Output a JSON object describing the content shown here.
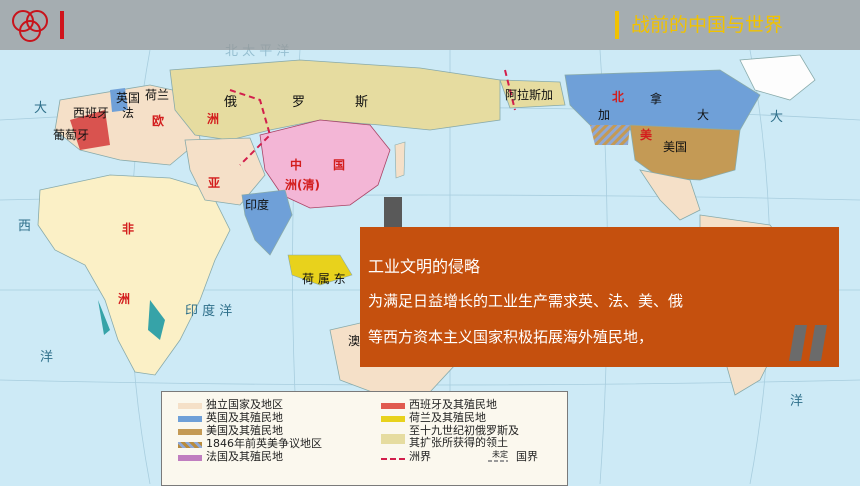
{
  "header": {
    "title": "战前的中国与世界"
  },
  "map_labels": {
    "russia": [
      "俄",
      "罗",
      "斯"
    ],
    "china": [
      "中",
      "国",
      "洲(清)"
    ],
    "europe": [
      "欧",
      "洲",
      "亚"
    ],
    "africa": [
      "非",
      "洲"
    ],
    "alaska": "阿拉斯加",
    "canada": [
      "加",
      "拿",
      "大"
    ],
    "north_america": [
      "北",
      "美"
    ],
    "usa": "美国",
    "britain": "英国",
    "holland": "荷兰",
    "france": "法",
    "spain": "西班牙",
    "portugal": "葡萄牙",
    "india": "印度",
    "dutch_indies": "荷 属 东",
    "west_letter": "西",
    "east_letter": "大",
    "indian_ocean": "印   度   洋",
    "ocean_left": "洋",
    "pacific_top": "北     太     平     洋",
    "ocean_right": "大",
    "ocean_right2": "洋",
    "aus_fragment": "澳"
  },
  "popup": {
    "title": "工业文明的侵略",
    "lines": [
      "为满足日益增长的工业生产需求英、法、美、俄",
      "等西方资本主义国家积极拓展海外殖民地，"
    ]
  },
  "legend": {
    "items": [
      {
        "label": "独立国家及地区",
        "color": "#f5e0c8"
      },
      {
        "label": "英国及其殖民地",
        "color": "#6fa0d8"
      },
      {
        "label": "美国及其殖民地",
        "color": "#c49a55"
      },
      {
        "label": "1846年前英美争议地区",
        "color": "hatch"
      },
      {
        "label": "法国及其殖民地",
        "color": "#c07ec0"
      },
      {
        "label": "西班牙及其殖民地",
        "color": "#e05a4f"
      },
      {
        "label": "荷兰及其殖民地",
        "color": "#e8d21c"
      },
      {
        "label": "至十九世纪初俄罗斯及",
        "color": "#e6dca0"
      },
      {
        "label": "其扩张所获得的领土",
        "color": ""
      },
      {
        "label": "洲界",
        "color": "#d21e4c"
      },
      {
        "label": "国界",
        "color": "#9a9a9a"
      },
      {
        "label": "未定",
        "color": ""
      }
    ]
  },
  "colors": {
    "ocean": "#cdeaf6",
    "russia": "#e6dca0",
    "china": "#f3b6d6",
    "britain": "#6fa0d8",
    "usa": "#c49a55",
    "popup": "#c5500e",
    "title": "#f1c200"
  }
}
